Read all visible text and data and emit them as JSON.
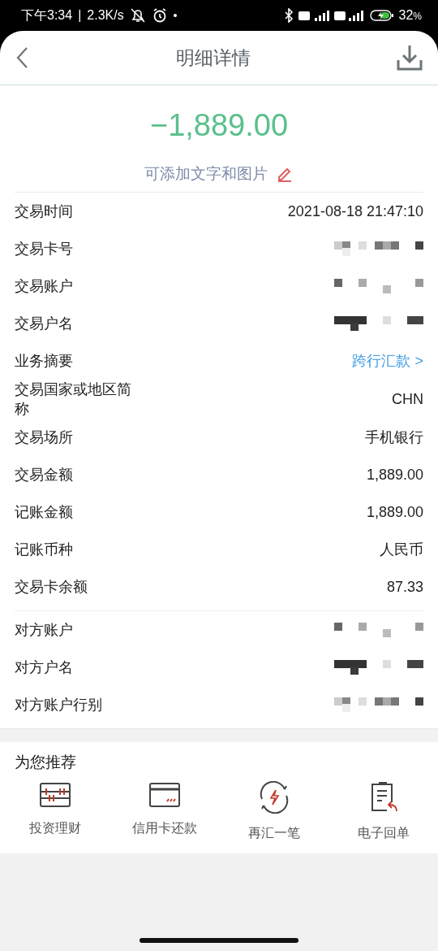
{
  "status_bar": {
    "time": "下午3:34",
    "separator": "|",
    "speed": "2.3K/s",
    "battery": "32",
    "battery_unit": "%"
  },
  "header": {
    "title": "明细详情"
  },
  "amount": "−1,889.00",
  "note_hint": "可添加文字和图片",
  "sections": [
    {
      "rows": [
        {
          "label": "交易时间",
          "kind": "text",
          "value": "2021-08-18 21:47:10"
        },
        {
          "label": "交易卡号",
          "kind": "redacted"
        },
        {
          "label": "交易账户",
          "kind": "redacted"
        },
        {
          "label": "交易户名",
          "kind": "redacted"
        },
        {
          "label": "业务摘要",
          "kind": "link",
          "value": "跨行汇款 >"
        },
        {
          "label": "交易国家或地区简称",
          "kind": "text",
          "value": "CHN"
        },
        {
          "label": "交易场所",
          "kind": "text",
          "value": "手机银行"
        },
        {
          "label": "交易金额",
          "kind": "text",
          "value": "1,889.00"
        },
        {
          "label": "记账金额",
          "kind": "text",
          "value": "1,889.00"
        },
        {
          "label": "记账币种",
          "kind": "text",
          "value": "人民币"
        },
        {
          "label": "交易卡余额",
          "kind": "text",
          "value": "87.33"
        }
      ]
    },
    {
      "rows": [
        {
          "label": "对方账户",
          "kind": "redacted"
        },
        {
          "label": "对方户名",
          "kind": "redacted"
        },
        {
          "label": "对方账户行别",
          "kind": "redacted"
        }
      ]
    }
  ],
  "recommend": {
    "title": "为您推荐",
    "items": [
      {
        "label": "投资理财",
        "kind": "abacus"
      },
      {
        "label": "信用卡还款",
        "kind": "card"
      },
      {
        "label": "再汇一笔",
        "kind": "repeat"
      },
      {
        "label": "电子回单",
        "kind": "receipt"
      }
    ]
  }
}
